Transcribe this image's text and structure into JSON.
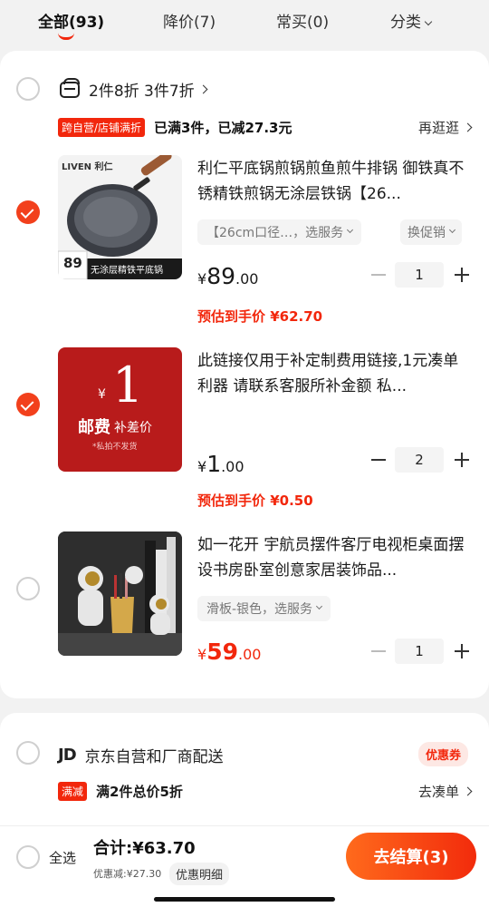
{
  "tabs": [
    {
      "label": "全部(93)",
      "active": true
    },
    {
      "label": "降价(7)",
      "active": false
    },
    {
      "label": "常买(0)",
      "active": false
    },
    {
      "label": "分类",
      "active": false
    }
  ],
  "store1": {
    "title": "2件8折 3件7折",
    "promo_badge": "跨自营/店铺满折",
    "promo_text": "已满3件，已减27.3元",
    "promo_link": "再逛逛"
  },
  "products": [
    {
      "checked": true,
      "thumb_brand": "LIVEN 利仁",
      "thumb_price": "89",
      "thumb_caption": "无涂层精铁平底锅",
      "title": "利仁平底锅煎锅煎鱼煎牛排锅 御铁真不锈精铁煎锅无涂层铁锅【26...",
      "spec": "【26cm口径…，选服务",
      "promo_select": "换促销",
      "price_symbol": "¥",
      "price_int": "89",
      "price_dec": ".00",
      "estimate": "预估到手价 ¥62.70",
      "quantity": "1"
    },
    {
      "checked": true,
      "thumb_amount": "1",
      "thumb_currency": "¥",
      "thumb_label_main": "邮费",
      "thumb_label_sub": "补差价",
      "thumb_note": "*私拍不发货",
      "title": "此链接仅用于补定制费用链接,1元凑单利器 请联系客服所补金额 私...",
      "price_symbol": "¥",
      "price_int": "1",
      "price_dec": ".00",
      "estimate": "预估到手价 ¥0.50",
      "quantity": "2"
    },
    {
      "checked": false,
      "title": "如一花开 宇航员摆件客厅电视柜桌面摆设书房卧室创意家居装饰品...",
      "spec": "滑板-银色，选服务",
      "price_symbol": "¥",
      "price_int": "59",
      "price_dec": ".00",
      "quantity": "1"
    }
  ],
  "store2": {
    "logo": "JD",
    "title": "京东自营和厂商配送",
    "coupon": "优惠券",
    "promo_badge": "满减",
    "promo_text": "满2件总价5折",
    "promo_link": "去凑单"
  },
  "bottom": {
    "select_all": "全选",
    "total": "合计:¥63.70",
    "discount": "优惠减:¥27.30",
    "detail": "优惠明细",
    "checkout": "去结算(3)"
  },
  "colors": {
    "accent": "#f2270c",
    "checkout_start": "#ff6a1c"
  }
}
